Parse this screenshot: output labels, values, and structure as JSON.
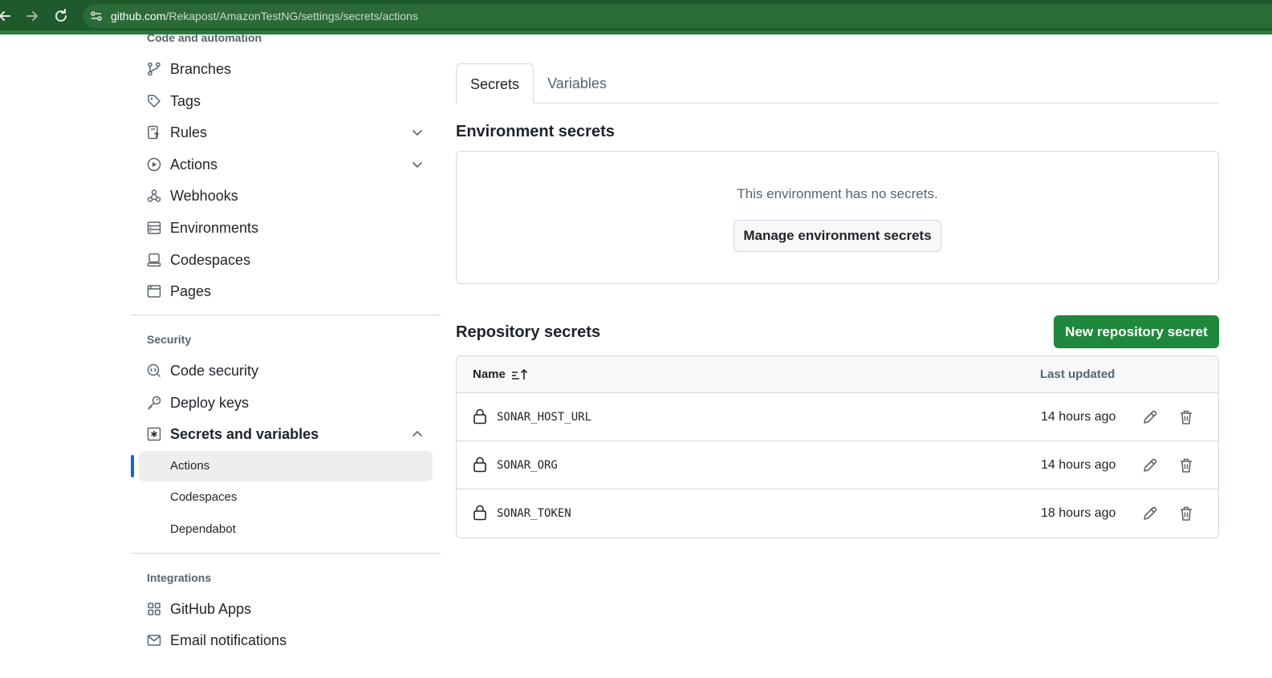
{
  "browser": {
    "url_host": "github.com",
    "url_path": "/Rekapost/AmazonTestNG/settings/secrets/actions",
    "back_icon": "arrow-left-icon",
    "forward_icon": "arrow-right-icon",
    "reload_icon": "reload-icon"
  },
  "sidebar": {
    "heading_code": "Code and automation",
    "items_code": [
      {
        "label": "Branches",
        "icon": "branch-icon"
      },
      {
        "label": "Tags",
        "icon": "tag-icon"
      },
      {
        "label": "Rules",
        "icon": "rules-icon",
        "expandable": true
      },
      {
        "label": "Actions",
        "icon": "play-icon",
        "expandable": true
      },
      {
        "label": "Webhooks",
        "icon": "webhook-icon"
      },
      {
        "label": "Environments",
        "icon": "server-icon"
      },
      {
        "label": "Codespaces",
        "icon": "codespaces-icon"
      },
      {
        "label": "Pages",
        "icon": "browser-icon"
      }
    ],
    "heading_security": "Security",
    "items_security": [
      {
        "label": "Code security",
        "icon": "codescan-icon"
      },
      {
        "label": "Deploy keys",
        "icon": "key-icon"
      },
      {
        "label": "Secrets and variables",
        "icon": "asterisk-icon",
        "expanded": true
      }
    ],
    "sub_items": [
      {
        "label": "Actions",
        "active": true
      },
      {
        "label": "Codespaces"
      },
      {
        "label": "Dependabot"
      }
    ],
    "heading_integrations": "Integrations",
    "items_integrations": [
      {
        "label": "GitHub Apps",
        "icon": "apps-icon"
      },
      {
        "label": "Email notifications",
        "icon": "mail-icon"
      }
    ]
  },
  "main": {
    "tabs": [
      {
        "label": "Secrets",
        "active": true
      },
      {
        "label": "Variables"
      }
    ],
    "env_title": "Environment secrets",
    "env_empty": "This environment has no secrets.",
    "env_button": "Manage environment secrets",
    "repo_title": "Repository secrets",
    "new_secret_button": "New repository secret",
    "table": {
      "col_name": "Name",
      "col_updated": "Last updated",
      "rows": [
        {
          "name": "SONAR_HOST_URL",
          "updated": "14 hours ago"
        },
        {
          "name": "SONAR_ORG",
          "updated": "14 hours ago"
        },
        {
          "name": "SONAR_TOKEN",
          "updated": "18 hours ago"
        }
      ]
    }
  },
  "colors": {
    "primary_button": "#1f883d",
    "active_marker": "#0969da",
    "browser_bar": "#1e5a2b"
  }
}
